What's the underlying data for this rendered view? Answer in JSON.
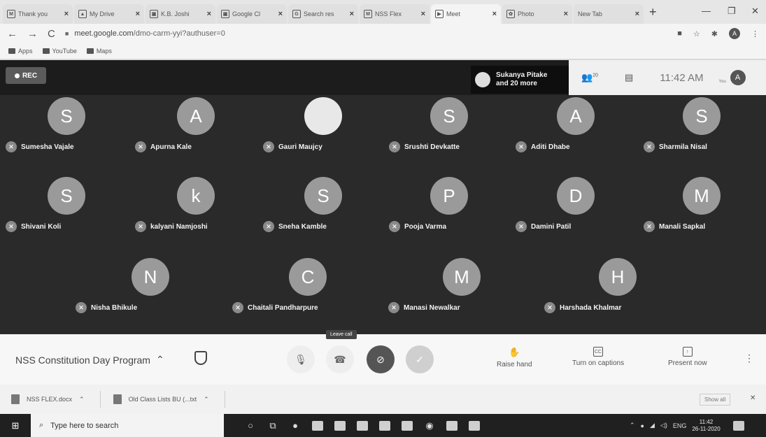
{
  "browser": {
    "tabs": [
      {
        "label": "Thank you",
        "icon": "gmail-icon",
        "glyph": "M",
        "active": false
      },
      {
        "label": "My Drive",
        "icon": "drive-icon",
        "glyph": "▲",
        "active": false
      },
      {
        "label": "K.B. Joshi",
        "icon": "classroom-icon",
        "glyph": "▣",
        "active": false
      },
      {
        "label": "Google Cl",
        "icon": "classroom-icon",
        "glyph": "▣",
        "active": false
      },
      {
        "label": "Search res",
        "icon": "google-icon",
        "glyph": "G",
        "active": false
      },
      {
        "label": "NSS Flex",
        "icon": "gmail-icon",
        "glyph": "M",
        "active": false
      },
      {
        "label": "Meet",
        "icon": "meet-icon",
        "glyph": "▶",
        "active": true
      },
      {
        "label": "Photo",
        "icon": "photos-icon",
        "glyph": "✿",
        "active": false
      },
      {
        "label": "New Tab",
        "icon": "",
        "glyph": "",
        "active": false
      }
    ],
    "url_host": "meet.google.com",
    "url_rest": "/dmo-carm-yyi?authuser=0",
    "profile_initial": "A",
    "bookmarks": [
      {
        "label": "Apps",
        "icon": "apps-icon"
      },
      {
        "label": "YouTube",
        "icon": "youtube-icon"
      },
      {
        "label": "Maps",
        "icon": "maps-icon"
      }
    ]
  },
  "meet": {
    "rec_label": "REC",
    "presenter_name": "Sukanya Pitake",
    "presenter_more": "and 20 more",
    "people_count": "20",
    "time": "11:42 AM",
    "you_label": "You",
    "you_initial": "A",
    "participants": [
      {
        "initial": "S",
        "name": "Sumesha Vajale"
      },
      {
        "initial": "A",
        "name": "Apurna Kale"
      },
      {
        "initial": "",
        "name": "Gauri Maujcy",
        "photo": true
      },
      {
        "initial": "S",
        "name": "Srushti Devkatte"
      },
      {
        "initial": "A",
        "name": "Aditi Dhabe"
      },
      {
        "initial": "S",
        "name": "Sharmila Nisal"
      },
      {
        "initial": "S",
        "name": "Shivani Koli"
      },
      {
        "initial": "k",
        "name": "kalyani Namjoshi"
      },
      {
        "initial": "S",
        "name": "Sneha Kamble"
      },
      {
        "initial": "P",
        "name": "Pooja Varma"
      },
      {
        "initial": "D",
        "name": "Damini Patil"
      },
      {
        "initial": "M",
        "name": "Manali Sapkal"
      },
      {
        "initial": "N",
        "name": "Nisha Bhikule"
      },
      {
        "initial": "C",
        "name": "Chaitali Pandharpure"
      },
      {
        "initial": "M",
        "name": "Manasi Newalkar"
      },
      {
        "initial": "H",
        "name": "Harshada Khalmar"
      }
    ],
    "meeting_title": "NSS Constitution Day Program",
    "leave_tooltip": "Leave call",
    "raise_hand_label": "Raise hand",
    "captions_label": "Turn on captions",
    "present_label": "Present now"
  },
  "downloads": {
    "items": [
      {
        "label": "NSS FLEX.docx"
      },
      {
        "label": "Old Class Lists BU (...txt"
      }
    ],
    "show_all": "Show all"
  },
  "taskbar": {
    "search_placeholder": "Type here to search",
    "lang": "ENG",
    "time": "11:42",
    "date": "26-11-2020"
  }
}
